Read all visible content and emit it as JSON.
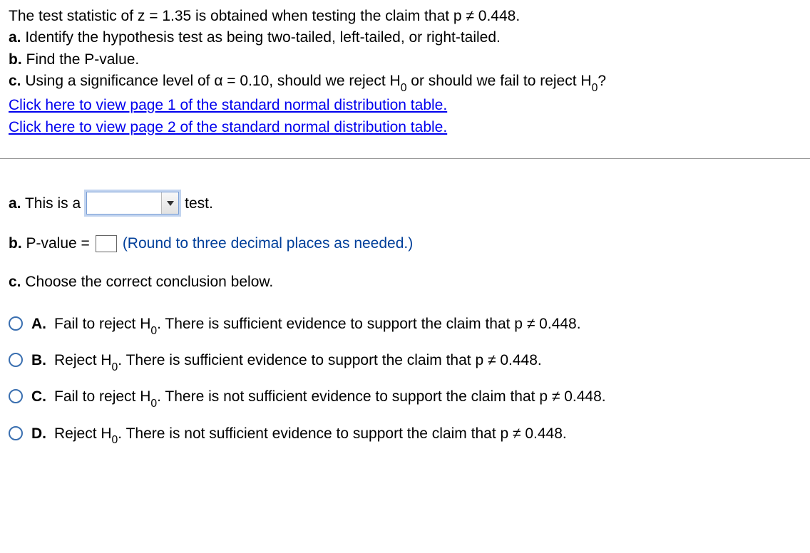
{
  "problem": {
    "intro": "The test statistic of z = 1.35 is obtained when testing the claim that p ≠ 0.448.",
    "a_label": "a.",
    "a_text": " Identify the hypothesis test as being two-tailed, left-tailed, or right-tailed.",
    "b_label": "b.",
    "b_text": " Find the P-value.",
    "c_label": "c.",
    "c_text_before": " Using a significance level of α = 0.10, should we reject H",
    "c_text_mid": " or should we fail to reject H",
    "c_text_after": "?",
    "h_sub": "0",
    "link1": "Click here to view page 1 of the standard normal distribution table.",
    "link2": "Click here to view page 2 of the standard normal distribution table."
  },
  "answers": {
    "a_prefix": "a.",
    "a_before": " This is a",
    "a_after": "test.",
    "b_prefix": "b.",
    "b_before": " P-value =",
    "b_hint": "(Round to three decimal places as needed.)",
    "c_prefix": "c.",
    "c_text": " Choose the correct conclusion below."
  },
  "options": [
    {
      "letter": "A.",
      "before": "Fail to reject H",
      "after": ". There is sufficient evidence to support the claim that p ≠ 0.448."
    },
    {
      "letter": "B.",
      "before": "Reject H",
      "after": ". There is sufficient evidence to support the claim that p ≠ 0.448."
    },
    {
      "letter": "C.",
      "before": "Fail to reject H",
      "after": ". There is not sufficient evidence to support the claim that p ≠ 0.448."
    },
    {
      "letter": "D.",
      "before": "Reject H",
      "after": ". There is not sufficient evidence to support the claim that p ≠ 0.448."
    }
  ],
  "h_sub": "0"
}
